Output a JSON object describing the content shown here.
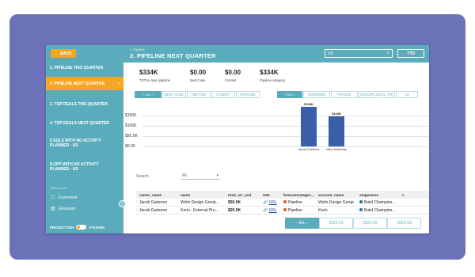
{
  "sidebar": {
    "back_label": "BACK",
    "items": [
      {
        "label": "1. PIPELINE THIS QUARTER"
      },
      {
        "label": "2. PIPELINE NEXT QUARTER"
      },
      {
        "label": "3. TOP DEALS THIS QUARTER"
      },
      {
        "label": "4. TOP DEALS NEXT QUARTER"
      },
      {
        "label": "5.SQLS WITH NO ACTIVITY PLANNED - US"
      },
      {
        "label": "6.OPP WITH NO ACTIVITY PLANNED - US"
      }
    ],
    "section_label": "Resources",
    "links": [
      {
        "label": "Comment",
        "icon": "comment-icon"
      },
      {
        "label": "Glossary",
        "icon": "book-icon"
      }
    ],
    "env_left": "PRODUCTION",
    "env_right": "STAGING"
  },
  "header": {
    "breadcrumb": "2. Pipeline",
    "title": "2. PIPELINE NEXT QUARTER",
    "search_value": "US",
    "period": "YTD"
  },
  "kpis": [
    {
      "value": "$334K",
      "label": "TOTAL open pipeline"
    },
    {
      "value": "$0.00",
      "label": "Best Case"
    },
    {
      "value": "$0.00",
      "label": "Commit"
    },
    {
      "value": "$334K",
      "label": "Pipeline category"
    }
  ],
  "filters_left": [
    "-- ALL --",
    "BEST CASE",
    "OMITTED",
    "COMMIT",
    "PIPELINE"
  ],
  "filters_right": [
    "-- ALL --",
    "UNKNOWN",
    "FRANCE",
    "EUROPE (EXCL. FR)",
    "US"
  ],
  "chart_data": {
    "type": "bar",
    "categories": [
      "Jacob Gutierrez",
      "Mark Mckinney"
    ],
    "values": [
      190,
      144
    ],
    "data_labels": [
      "$190K",
      "$144K"
    ],
    "y_ticks": [
      "$150K",
      "$100K",
      "$50.0K",
      "$0.00"
    ],
    "ylim": [
      0,
      190
    ],
    "grid": true
  },
  "table_controls": {
    "search_placeholder": "Search",
    "select_value": "All"
  },
  "table": {
    "columns": [
      "owner_name",
      "name",
      "total_arr_usd",
      "URL",
      "forecastcategoryname",
      "account_name",
      "stagename",
      "c"
    ],
    "rows": [
      [
        "Jacob Gutierrez",
        "Wolin Design Group...",
        "$50.0K",
        "URL",
        "Pipeline",
        "Wolin Design Group",
        "Build Champion...",
        ""
      ],
      [
        "Jacob Gutierrez",
        "Korio - External Pro...",
        "$20.0K",
        "URL",
        "Pipeline",
        "Korio",
        "Build Champion...",
        ""
      ]
    ]
  },
  "pagination": [
    "-- ALL --",
    "2023-01",
    "2023-02",
    "2023-03"
  ],
  "colors": {
    "sidebar": "#5aacbc",
    "accent": "#f5a623",
    "bar": "#3a5ea8",
    "frame": "#6b72b8",
    "pipeline_dot": "#e8531f",
    "stage_dot": "#3a5ea8"
  }
}
